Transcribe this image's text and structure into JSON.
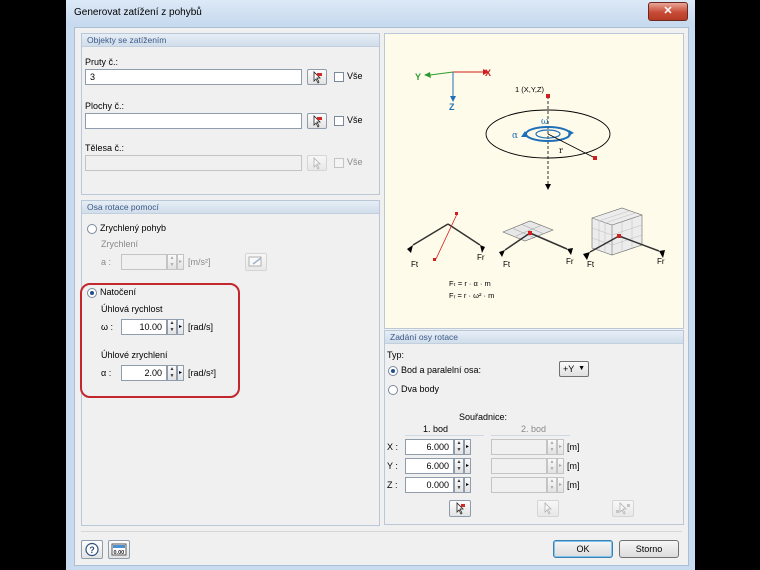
{
  "window": {
    "title": "Generovat zatížení z pohybů",
    "close_glyph": "✕"
  },
  "objects": {
    "header": "Objekty se zatížením",
    "members_label": "Pruty č.:",
    "members_value": "3",
    "surfaces_label": "Plochy č.:",
    "surfaces_value": "",
    "solids_label": "Tělesa č.:",
    "solids_value": "",
    "all_label": "Vše"
  },
  "rotation_axis_source": {
    "header": "Osa rotace pomocí",
    "accel_option": "Zrychlený pohyb",
    "accel_label": "Zrychlení",
    "a_symbol": "a :",
    "a_value": "",
    "a_unit": "[m/s²]",
    "rotation_option": "Natočení",
    "angular_velocity_label": "Úhlová rychlost",
    "omega_symbol": "ω :",
    "omega_value": "10.00",
    "omega_unit": "[rad/s]",
    "angular_accel_label": "Úhlové zrychlení",
    "alpha_symbol": "α :",
    "alpha_value": "2.00",
    "alpha_unit": "[rad/s²]",
    "selected": "rotation"
  },
  "figure": {
    "axis_x": "X",
    "axis_y": "Y",
    "axis_z": "Z",
    "point_label": "1 (X,Y,Z)",
    "alpha": "α",
    "omega": "ω",
    "r": "r",
    "ft": "Ft",
    "fr": "Fr",
    "formula_ft": "Fₜ = r · α · m",
    "formula_fr": "Fᵣ = r · ω² · m"
  },
  "axis_definition": {
    "header": "Zadání osy rotace",
    "type_label": "Typ:",
    "option_point_parallel": "Bod a paralelní osa:",
    "option_two_points": "Dva body",
    "axis_direction": "+Y",
    "coords_label": "Souřadnice:",
    "col1": "1. bod",
    "col2": "2. bod",
    "rows": [
      {
        "axis": "X :",
        "p1": "6.000",
        "p2": "",
        "unit": "[m]"
      },
      {
        "axis": "Y :",
        "p1": "6.000",
        "p2": "",
        "unit": "[m]"
      },
      {
        "axis": "Z :",
        "p1": "0.000",
        "p2": "",
        "unit": "[m]"
      }
    ]
  },
  "footer": {
    "ok": "OK",
    "cancel": "Storno"
  },
  "colors": {
    "red": "#d11f1f",
    "blue": "#1f6fb8",
    "green": "#2e9a2e",
    "highlight": "#c1272d"
  }
}
